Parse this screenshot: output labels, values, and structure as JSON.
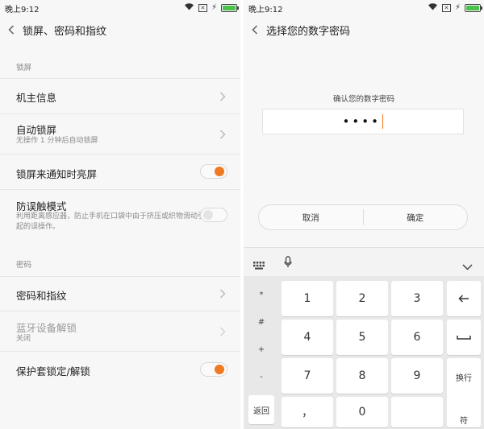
{
  "left": {
    "status": {
      "time": "晚上9:12",
      "sim": "✕"
    },
    "header": {
      "title": "锁屏、密码和指纹"
    },
    "sections": {
      "lock": "锁屏",
      "password": "密码"
    },
    "rows": {
      "owner": {
        "title": "机主信息"
      },
      "autolock": {
        "title": "自动锁屏",
        "subtitle": "无操作 1 分钟后自动锁屏"
      },
      "notify": {
        "title": "锁屏来通知时亮屏",
        "on": true
      },
      "antimis": {
        "title": "防误触模式",
        "subtitle": "利用距离感应器，防止手机在口袋中由于挤压或织物滑动引起的误操作。",
        "on": false
      },
      "pwd": {
        "title": "密码和指纹"
      },
      "bluetooth": {
        "title": "蓝牙设备解锁",
        "subtitle": "关闭"
      },
      "cover": {
        "title": "保护套锁定/解锁",
        "on": true
      }
    }
  },
  "right": {
    "status": {
      "time": "晚上9:12",
      "sim": "✕"
    },
    "header": {
      "title": "选择您的数字密码"
    },
    "confirm_label": "确认您的数字密码",
    "pin_masked": "••••",
    "cancel_label": "取消",
    "ok_label": "确定",
    "keyboard": {
      "side_keys": [
        "*",
        "#",
        "+",
        "-"
      ],
      "back_label": "返回",
      "digits": [
        "1",
        "2",
        "3",
        "4",
        "5",
        "6",
        "7",
        "8",
        "9"
      ],
      "comma": "，",
      "zero": "0",
      "newline_label": "换行",
      "enter_label": "符"
    }
  },
  "colors": {
    "accent": "#f07a20",
    "battery": "#4bc24b"
  }
}
